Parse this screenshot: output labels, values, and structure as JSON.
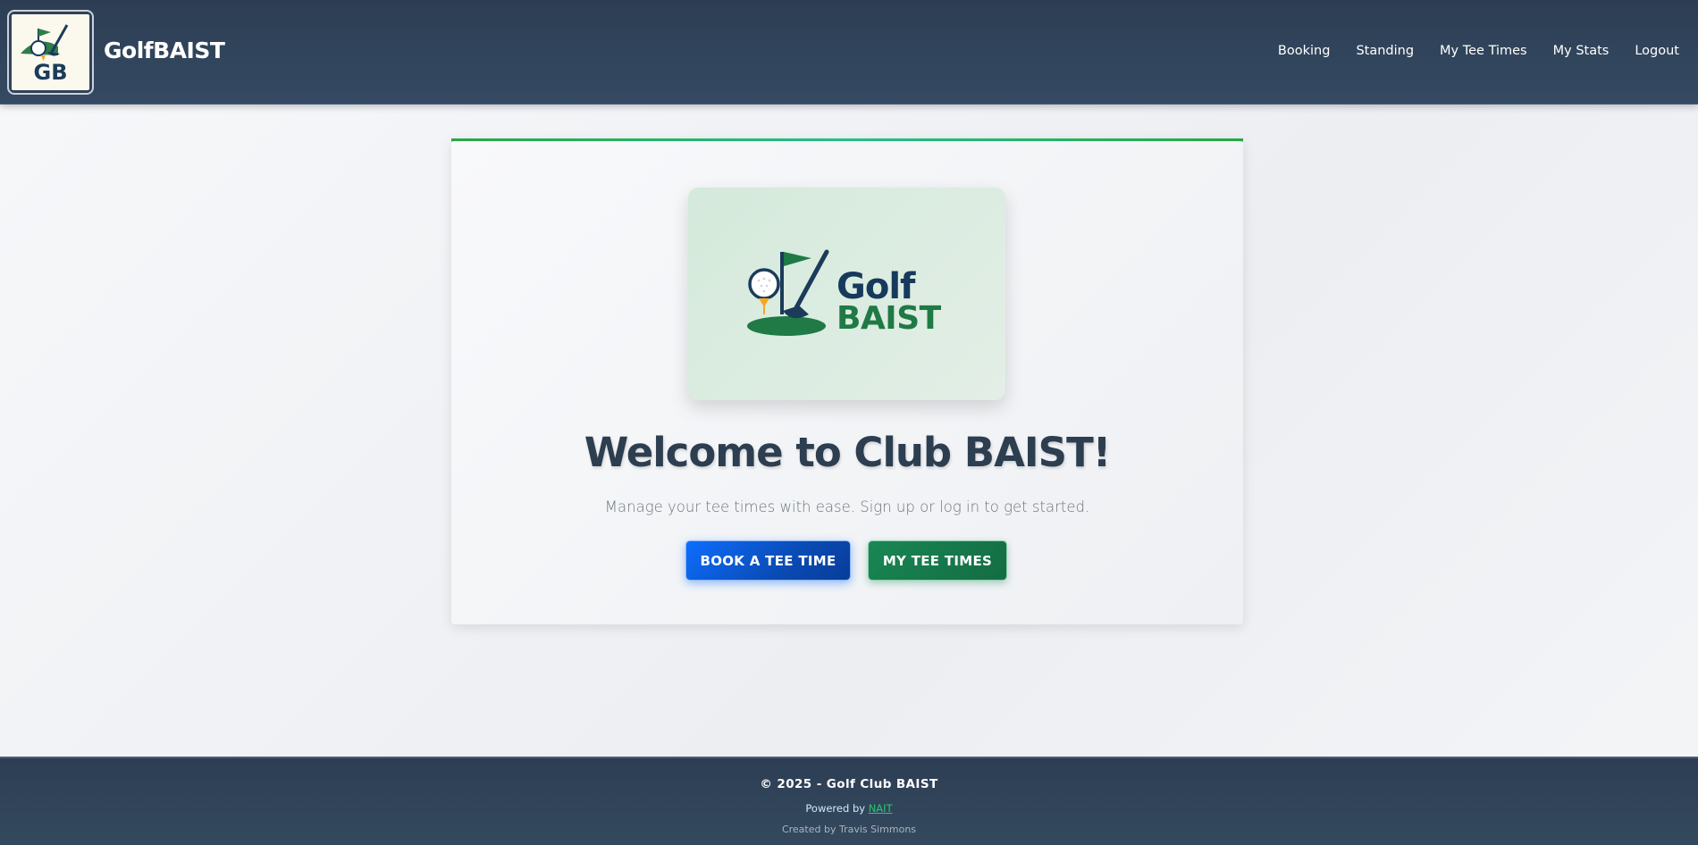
{
  "header": {
    "brand_name": "GolfBAIST",
    "logo_text": "GB",
    "nav": [
      {
        "label": "Booking"
      },
      {
        "label": "Standing"
      },
      {
        "label": "My Tee Times"
      },
      {
        "label": "My Stats"
      },
      {
        "label": "Logout"
      }
    ]
  },
  "hero": {
    "logo_word_1": "Golf",
    "logo_word_2": "BAIST",
    "title": "Welcome to Club BAIST!",
    "subtitle": "Manage your tee times with ease. Sign up or log in to get started.",
    "book_button": "BOOK A TEE TIME",
    "my_button": "MY TEE TIMES"
  },
  "footer": {
    "copyright": "© 2025 - Golf Club BAIST",
    "powered_prefix": "Powered by ",
    "powered_link": "NAIT",
    "credit": "Created by Travis Simmons"
  },
  "colors": {
    "navbar": "#2d3e54",
    "accent_green": "#28a745",
    "primary_blue": "#0d6efd",
    "success_green": "#198754",
    "title_text": "#2c3e50"
  },
  "icons": [
    "golf-club-logo-icon",
    "flag-icon",
    "golf-ball-icon",
    "tee-icon"
  ]
}
